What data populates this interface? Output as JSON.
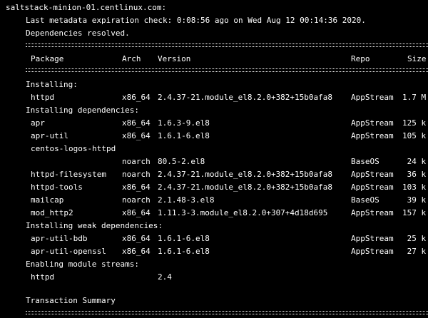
{
  "terminal": {
    "host_line": "saltstack-minion-01.centlinux.com:",
    "metadata_line": "Last metadata expiration check: 0:08:56 ago on Wed Aug 12 00:14:36 2020.",
    "deps_resolved": "Dependencies resolved.",
    "headers": {
      "package": "Package",
      "arch": "Arch",
      "version": "Version",
      "repo": "Repo",
      "size": "Size"
    },
    "sections": {
      "installing": "Installing:",
      "installing_dependencies": "Installing dependencies:",
      "installing_weak": "Installing weak dependencies:",
      "enabling_streams": "Enabling module streams:",
      "transaction_summary": "Transaction Summary"
    },
    "installing": [
      {
        "package": "httpd",
        "arch": "x86_64",
        "version": "2.4.37-21.module_el8.2.0+382+15b0afa8",
        "repo": "AppStream",
        "size": "1.7 M"
      }
    ],
    "dependencies": [
      {
        "package": "apr",
        "arch": "x86_64",
        "version": "1.6.3-9.el8",
        "repo": "AppStream",
        "size": "125 k"
      },
      {
        "package": "apr-util",
        "arch": "x86_64",
        "version": "1.6.1-6.el8",
        "repo": "AppStream",
        "size": "105 k"
      },
      {
        "package": "centos-logos-httpd",
        "arch": "",
        "version": "",
        "repo": "",
        "size": ""
      },
      {
        "package": "",
        "arch": "noarch",
        "version": "80.5-2.el8",
        "repo": "BaseOS",
        "size": "24 k"
      },
      {
        "package": "httpd-filesystem",
        "arch": "noarch",
        "version": "2.4.37-21.module_el8.2.0+382+15b0afa8",
        "repo": "AppStream",
        "size": "36 k"
      },
      {
        "package": "httpd-tools",
        "arch": "x86_64",
        "version": "2.4.37-21.module_el8.2.0+382+15b0afa8",
        "repo": "AppStream",
        "size": "103 k"
      },
      {
        "package": "mailcap",
        "arch": "noarch",
        "version": "2.1.48-3.el8",
        "repo": "BaseOS",
        "size": "39 k"
      },
      {
        "package": "mod_http2",
        "arch": "x86_64",
        "version": "1.11.3-3.module_el8.2.0+307+4d18d695",
        "repo": "AppStream",
        "size": "157 k"
      }
    ],
    "weak_dependencies": [
      {
        "package": "apr-util-bdb",
        "arch": "x86_64",
        "version": "1.6.1-6.el8",
        "repo": "AppStream",
        "size": "25 k"
      },
      {
        "package": "apr-util-openssl",
        "arch": "x86_64",
        "version": "1.6.1-6.el8",
        "repo": "AppStream",
        "size": "27 k"
      }
    ],
    "module_streams": [
      {
        "package": "httpd",
        "stream": "2.4"
      }
    ]
  }
}
